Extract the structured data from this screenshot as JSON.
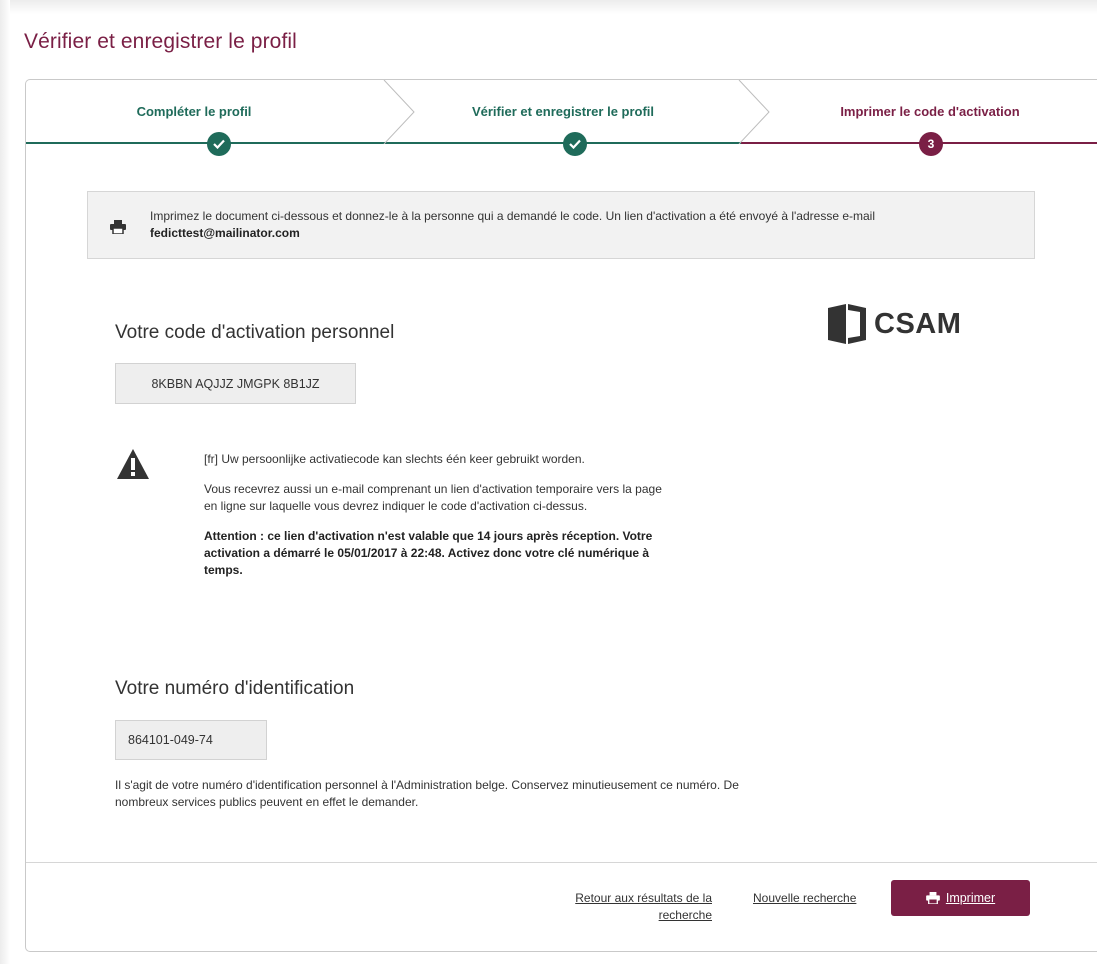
{
  "page_title": "Vérifier et enregistrer le profil",
  "colors": {
    "green": "#1f6b5a",
    "maroon": "#7a1f45"
  },
  "stepper": {
    "steps": [
      {
        "label": "Compléter le profil",
        "state": "done",
        "icon": "check-icon"
      },
      {
        "label": "Vérifier et enregistrer le profil",
        "state": "done",
        "icon": "check-icon"
      },
      {
        "label": "Imprimer le code d'activation",
        "state": "active",
        "number": "3"
      }
    ]
  },
  "info": {
    "icon": "printer-icon",
    "text": "Imprimez le document ci-dessous et donnez-le à la personne qui a demandé le code. Un lien d'activation a été envoyé à l'adresse e-mail",
    "email": "fedicttest@mailinator.com"
  },
  "activation": {
    "heading": "Votre code d'activation personnel",
    "code": "8KBBN AQJJZ JMGPK 8B1JZ",
    "logo_text": "CSAM"
  },
  "warning": {
    "icon": "warning-icon",
    "line1": "[fr] Uw persoonlijke activatiecode kan slechts één keer gebruikt worden.",
    "line2a": "Vous recevrez aussi un e-mail comprenant un lien d'activation temporaire vers la page",
    "line2b": "en ligne sur laquelle vous devrez indiquer le code d'activation ci-dessus.",
    "bold_a": "Attention : ce lien d'activation n'est valable que 14 jours après réception. Votre",
    "bold_b": "activation a démarré le 05/01/2017 à 22:48. Activez donc votre clé numérique à",
    "bold_c": "temps."
  },
  "identification": {
    "heading": "Votre numéro d'identification",
    "number": "864101-049-74",
    "desc_a": "Il s'agit de votre numéro d'identification personnel à l'Administration belge. Conservez minutieusement ce numéro. De",
    "desc_b": "nombreux services publics peuvent en effet le demander."
  },
  "footer": {
    "back_link_a": "Retour aux résultats de la",
    "back_link_b": "recherche",
    "new_search": "Nouvelle recherche",
    "print_button": "Imprimer"
  }
}
